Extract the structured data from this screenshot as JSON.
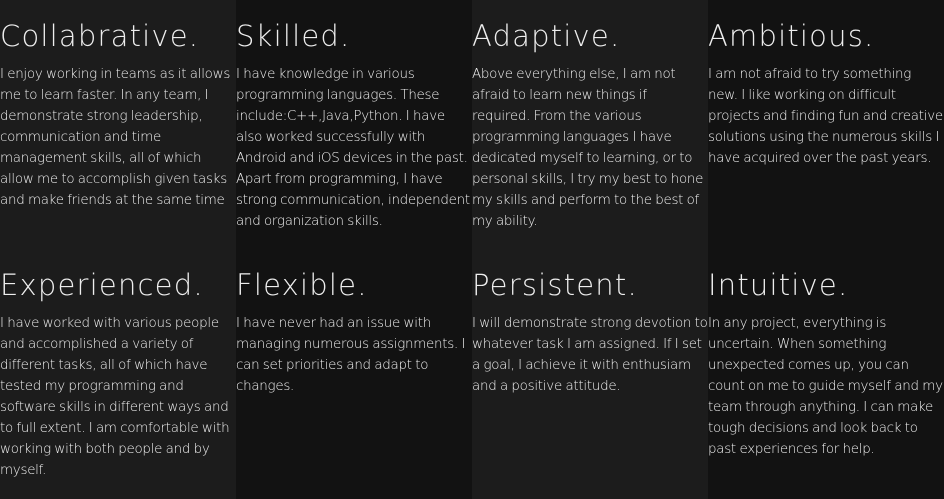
{
  "traits": [
    {
      "title": "Collabrative.",
      "text": "I enjoy working in teams as it allows me to learn faster. In any team, I demonstrate strong leadership, communication and time management skills, all of which allow me to accomplish given tasks and make friends at the same time"
    },
    {
      "title": "Skilled.",
      "text": "I have knowledge in various programming languages. These include:C++,Java,Python. I have also worked successfully with Android and iOS devices in the past. Apart from programming, I have strong communication, independent and organization skills."
    },
    {
      "title": "Adaptive.",
      "text": "Above everything else, I am not afraid to learn new things if required. From the various programming languages I have dedicated myself to learning, or to personal skills, I try my best to hone my skills and perform to the best of my ability."
    },
    {
      "title": "Ambitious.",
      "text": "I am not afraid to try something new. I like working on difficult projects and finding fun and creative solutions using the numerous skills I have acquired over the past years."
    },
    {
      "title": "Experienced.",
      "text": "I have worked with various people and accomplished a variety of different tasks, all of which have tested my programming and software skills in different ways and to full extent. I am comfortable with working with both people and by myself."
    },
    {
      "title": "Flexible.",
      "text": "I have never had an issue with managing numerous assignments. I can set priorities and adapt to changes."
    },
    {
      "title": "Persistent.",
      "text": "I will demonstrate strong devotion to whatever task I am assigned. If I set a goal, I achieve it with enthusiam and a positive attitude."
    },
    {
      "title": "Intuitive.",
      "text": "In any project, everything is uncertain. When something unexpected comes up, you can count on me to guide myself and my team through anything. I can make tough decisions and look back to past experiences for help."
    }
  ],
  "colors": {
    "tile_light": "#1c1c1c",
    "tile_dark": "#121212",
    "text": "#f2f2f2"
  }
}
